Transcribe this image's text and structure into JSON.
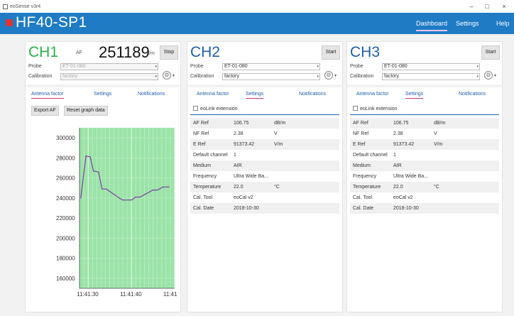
{
  "window": {
    "title": "eoSense v3r4",
    "min": "–",
    "max": "□",
    "close": "×"
  },
  "app": {
    "title": "HF40-SP1",
    "nav": [
      "Dashboard",
      "Settings",
      "Help"
    ]
  },
  "ch1": {
    "title": "CH1",
    "unit_label": "AF",
    "value": "251189",
    "value_unit": "/m",
    "button": "Stop",
    "probe_label": "Probe",
    "probe_value": "ET-01-080",
    "calibration_label": "Calibration",
    "calibration_value": "factory",
    "tabs": [
      "Antenna factor",
      "Settings",
      "Notifications"
    ],
    "export_label": "Export AF",
    "reset_label": "Reset graph data"
  },
  "ch2": {
    "title": "CH2",
    "button": "Start",
    "probe_label": "Probe",
    "probe_value": "ET-01-080",
    "calibration_label": "Calibration",
    "calibration_value": "factory",
    "tabs": [
      "Antenna factor",
      "Settings",
      "Notifications"
    ],
    "eolink_label": "eoLink extension",
    "settings": [
      {
        "key": "AF Ref",
        "value": "106.75",
        "unit": "dB/m"
      },
      {
        "key": "NF Ref",
        "value": "2.38",
        "unit": "V"
      },
      {
        "key": "E Ref",
        "value": "91373.42",
        "unit": "V/m"
      },
      {
        "key": "Default channel",
        "value": "1",
        "unit": ""
      },
      {
        "key": "Medium",
        "value": "AIR",
        "unit": ""
      },
      {
        "key": "Frequency",
        "value": "Ultra Wide Ba...",
        "unit": ""
      },
      {
        "key": "Temperature",
        "value": "22.0",
        "unit": "°C"
      },
      {
        "key": "Cal. Tool",
        "value": "eoCal v2",
        "unit": ""
      },
      {
        "key": "Cal. Date",
        "value": "2018-10-30",
        "unit": ""
      }
    ]
  },
  "ch3": {
    "title": "CH3",
    "button": "Start",
    "probe_label": "Probe",
    "probe_value": "ET-01-080",
    "calibration_label": "Calibration",
    "calibration_value": "factory",
    "tabs": [
      "Antenna factor",
      "Settings",
      "Notifications"
    ],
    "eolink_label": "eoLink extension",
    "settings": [
      {
        "key": "AF Ref",
        "value": "106.75",
        "unit": "dB/m"
      },
      {
        "key": "NF Ref",
        "value": "2.38",
        "unit": "V"
      },
      {
        "key": "E Ref",
        "value": "91373.42",
        "unit": "V/m"
      },
      {
        "key": "Default channel",
        "value": "1",
        "unit": ""
      },
      {
        "key": "Medium",
        "value": "AIR",
        "unit": ""
      },
      {
        "key": "Frequency",
        "value": "Ultra Wide Ba...",
        "unit": ""
      },
      {
        "key": "Temperature",
        "value": "22.0",
        "unit": "°C"
      },
      {
        "key": "Cal. Tool",
        "value": "eoCal v2",
        "unit": ""
      },
      {
        "key": "Cal. Date",
        "value": "2018-10-30",
        "unit": ""
      }
    ]
  },
  "colors": {
    "appbar": "#1e7bc4",
    "ch1_green": "#2bb24c",
    "chart_fill": "#9be3a8",
    "line": "#7b3fa0"
  },
  "chart_data": {
    "type": "line",
    "ylim": [
      150000,
      310000
    ],
    "yticks": [
      300000,
      280000,
      260000,
      240000,
      220000,
      200000,
      180000,
      160000
    ],
    "xticks": [
      "11:41:30",
      "11:41:40",
      "11:41"
    ],
    "xlim": [
      0,
      22
    ],
    "xtick_positions": [
      2,
      12,
      22
    ],
    "points": [
      [
        0.3,
        240000
      ],
      [
        1.5,
        282000
      ],
      [
        2.5,
        281000
      ],
      [
        3.2,
        267000
      ],
      [
        4.4,
        266000
      ],
      [
        5.2,
        249000
      ],
      [
        6.2,
        249000
      ],
      [
        9.2,
        240000
      ],
      [
        10.0,
        238000
      ],
      [
        12.0,
        238000
      ],
      [
        13.0,
        241000
      ],
      [
        14.0,
        241000
      ],
      [
        17.0,
        248000
      ],
      [
        18.0,
        248000
      ],
      [
        19.3,
        251000
      ],
      [
        20.7,
        251000
      ]
    ]
  }
}
